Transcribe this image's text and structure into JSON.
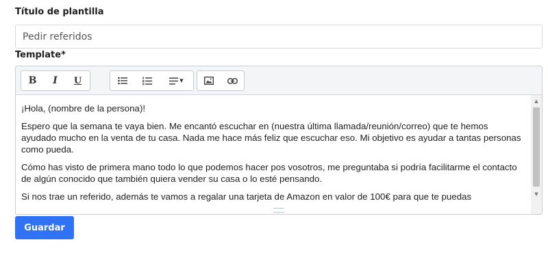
{
  "form": {
    "title_label": "Título de plantilla",
    "title_value": "Pedir referidos",
    "template_label": "Template*",
    "save_label": "Guardar"
  },
  "toolbar": {
    "bold": "B",
    "italic": "I",
    "underline": "U",
    "icons": [
      "bold-icon",
      "italic-icon",
      "underline-icon",
      "bulleted-list-icon",
      "numbered-list-icon",
      "align-icon",
      "image-icon",
      "link-icon"
    ]
  },
  "editor": {
    "paragraphs": [
      "¡Hola, (nombre de la persona)!",
      "Espero que la semana te vaya bien. Me encantó escuchar en (nuestra última llamada/reunión/correo) que te hemos ayudado mucho en la venta de tu casa. Nada me hace más feliz que escuchar eso. Mi objetivo es ayudar a tantas personas como pueda.",
      "Cómo has visto de primera mano todo lo que podemos hacer pos vosotros, me preguntaba si podría facilitarme el contacto de algún conocido que también quiera vender su casa o lo esté pensando.",
      "Si nos trae un referido, además te vamos a regalar una tarjeta de Amazon en valor de 100€ para que te puedas"
    ]
  },
  "colors": {
    "accent": "#2f73f4",
    "toolbar_bg": "#f4f5f6",
    "border": "#c9ced4"
  }
}
